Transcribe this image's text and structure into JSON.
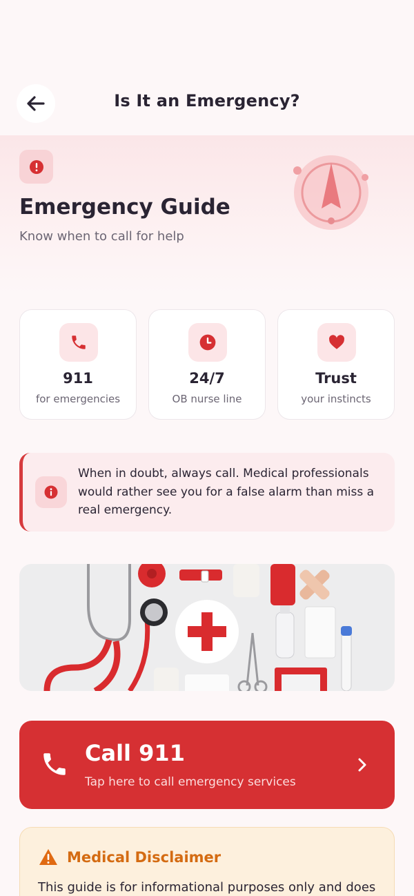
{
  "header": {
    "title": "Is It an Emergency?",
    "back_icon": "arrow-left-icon"
  },
  "hero": {
    "badge_icon": "alert-circle-icon",
    "title": "Emergency Guide",
    "subtitle": "Know when to call for help",
    "decoration_icon": "compass-icon"
  },
  "stats": [
    {
      "icon": "phone-icon",
      "value": "911",
      "label": "for emergencies"
    },
    {
      "icon": "clock-icon",
      "value": "24/7",
      "label": "OB nurse line"
    },
    {
      "icon": "heart-icon",
      "value": "Trust",
      "label": "your instincts"
    }
  ],
  "info": {
    "icon": "info-icon",
    "text": "When in doubt, always call. Medical professionals would rather see you for a false alarm than miss a real emergency."
  },
  "photo": {
    "subject": "first-aid-supplies-image"
  },
  "call": {
    "title": "Call 911",
    "subtitle": "Tap here to call emergency services",
    "icon": "phone-icon",
    "chevron": "chevron-right-icon"
  },
  "disclaimer": {
    "icon": "warning-triangle-icon",
    "title": "Medical Disclaimer",
    "text": "This guide is for informational purposes only and does"
  },
  "colors": {
    "accent_red": "#d63033",
    "hero_bg": "#fbe6e8",
    "warning_orange": "#d46b12",
    "page_bg": "#fdf7f8"
  }
}
